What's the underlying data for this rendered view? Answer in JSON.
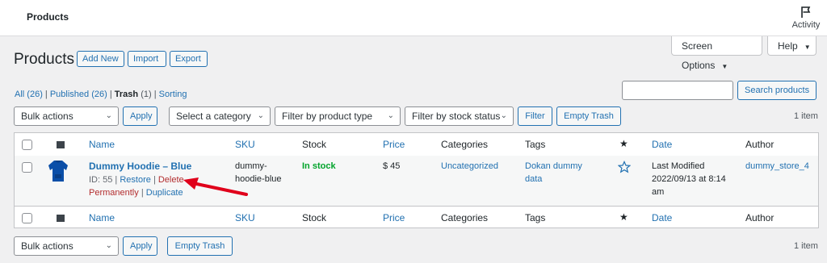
{
  "topbar": {
    "title": "Products",
    "activity_label": "Activity"
  },
  "screen_options": {
    "label": "Screen Options"
  },
  "help": {
    "label": "Help"
  },
  "page": {
    "title": "Products",
    "add_new": "Add New",
    "import": "Import",
    "export": "Export"
  },
  "subsubsub": {
    "all": "All",
    "all_count": "(26)",
    "published": "Published",
    "published_count": "(26)",
    "trash": "Trash",
    "trash_count": "(1)",
    "sorting": "Sorting",
    "sep": "|"
  },
  "search": {
    "button": "Search products",
    "value": ""
  },
  "filters": {
    "bulk_actions": "Bulk actions",
    "apply": "Apply",
    "category": "Select a category",
    "product_type": "Filter by product type",
    "stock_status": "Filter by stock status",
    "filter": "Filter",
    "empty_trash": "Empty Trash",
    "item_count": "1 item"
  },
  "columns": {
    "name": "Name",
    "sku": "SKU",
    "stock": "Stock",
    "price": "Price",
    "categories": "Categories",
    "tags": "Tags",
    "date": "Date",
    "author": "Author"
  },
  "row": {
    "name": "Dummy Hoodie – Blue",
    "id_text": "ID: 55",
    "restore": "Restore",
    "delete_1": "Delete",
    "delete_2": "Permanently",
    "duplicate": "Duplicate",
    "sku_1": "dummy-",
    "sku_2": "hoodie-blue",
    "stock": "In stock",
    "price": "$ 45",
    "category": "Uncategorized",
    "tags_1": "Dokan dummy",
    "tags_2": "data",
    "date_1": "Last Modified",
    "date_2": "2022/09/13 at 8:14",
    "date_3": "am",
    "author": "dummy_store_4"
  },
  "bottom": {
    "bulk_actions": "Bulk actions",
    "apply": "Apply",
    "empty_trash": "Empty Trash",
    "item_count": "1 item"
  },
  "icons": {
    "activity": "flag-icon",
    "thumbnail": "image-icon",
    "featured": "star-icon",
    "caret": "caret-down-icon"
  },
  "colors": {
    "link": "#2271b1",
    "in_stock": "#00a32a",
    "delete": "#b32d2e",
    "arrow": "#e0001b"
  }
}
